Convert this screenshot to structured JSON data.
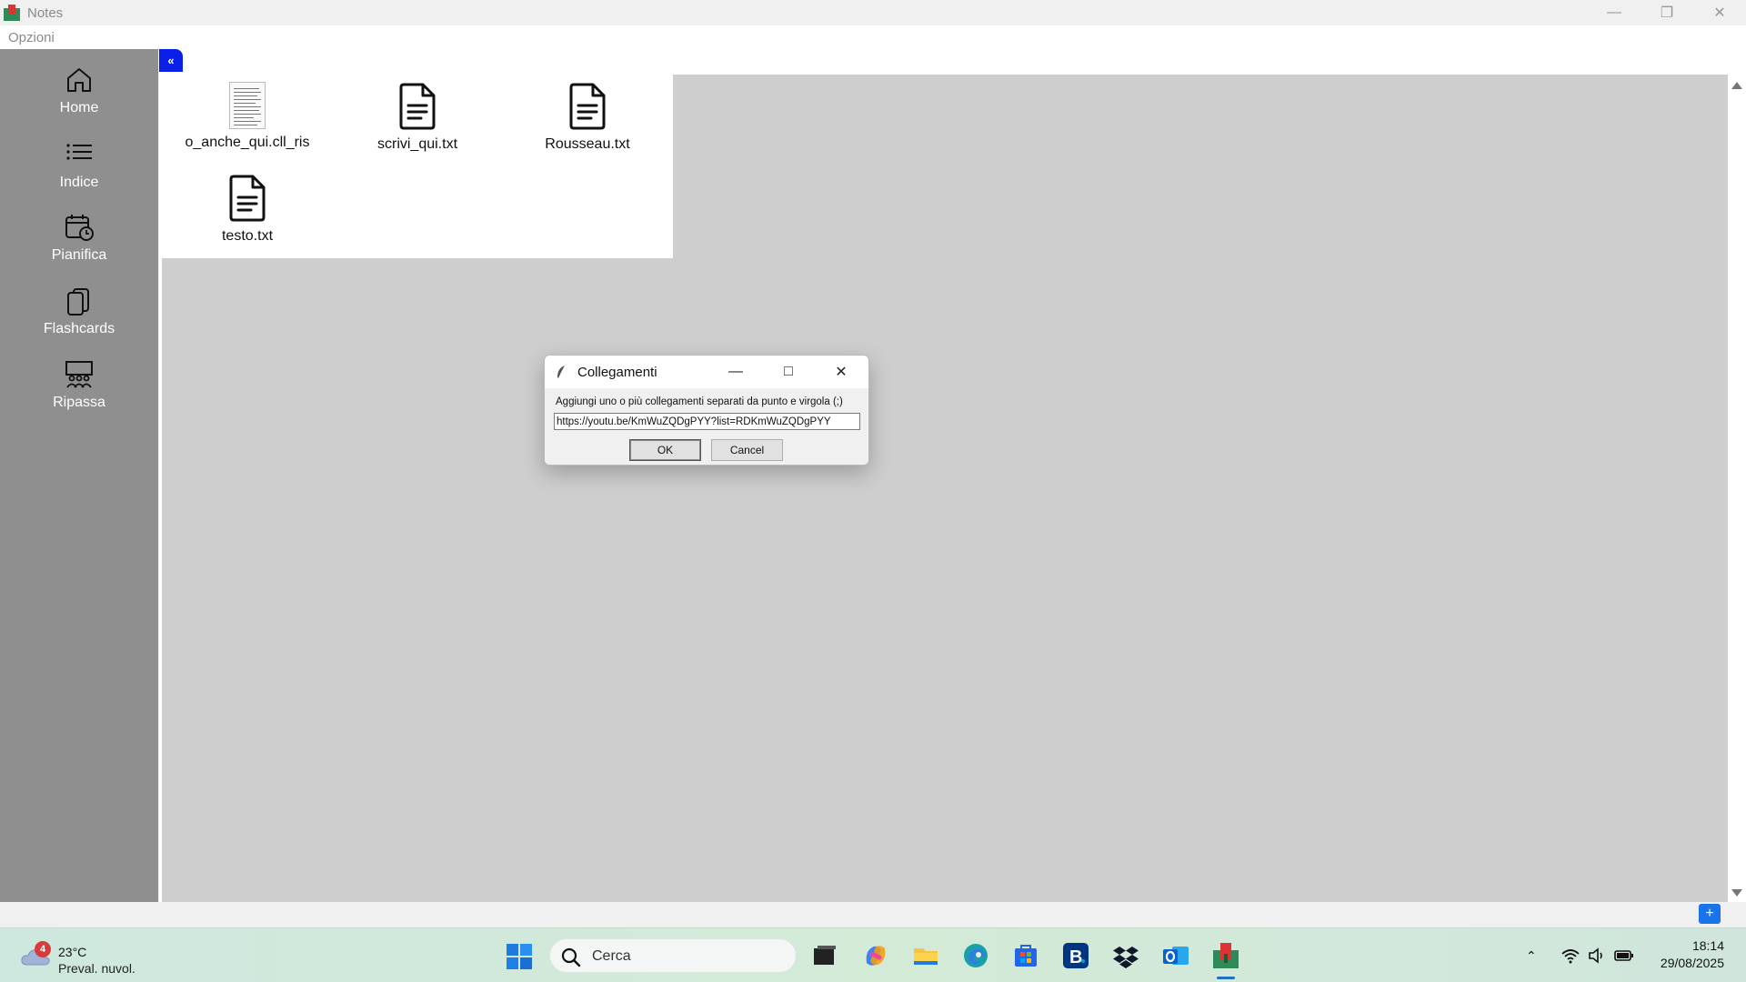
{
  "window": {
    "title": "Notes"
  },
  "menu": {
    "options": "Opzioni"
  },
  "sidebar": {
    "items": [
      {
        "label": "Home",
        "icon": "home-icon"
      },
      {
        "label": "Indice",
        "icon": "list-icon"
      },
      {
        "label": "Pianifica",
        "icon": "calendar-clock-icon"
      },
      {
        "label": "Flashcards",
        "icon": "cards-icon"
      },
      {
        "label": "Ripassa",
        "icon": "classroom-icon"
      }
    ]
  },
  "main": {
    "collapse_label": "«",
    "files": [
      {
        "name": "o_anche_qui.cll_ris",
        "icon": "document-thumbnail"
      },
      {
        "name": "scrivi_qui.txt",
        "icon": "text-file-icon"
      },
      {
        "name": "Rousseau.txt",
        "icon": "text-file-icon"
      },
      {
        "name": "testo.txt",
        "icon": "text-file-icon"
      }
    ],
    "add_label": "+"
  },
  "dialog": {
    "title": "Collegamenti",
    "prompt": "Aggiungi uno o più collegamenti separati da punto e virgola (;)",
    "input_value": "https://youtu.be/KmWuZQDgPYY?list=RDKmWuZQDgPYY",
    "ok_label": "OK",
    "cancel_label": "Cancel"
  },
  "taskbar": {
    "weather": {
      "badge": "4",
      "temp": "23°C",
      "condition": "Preval. nuvol."
    },
    "search_placeholder": "Cerca",
    "clock": {
      "time": "18:14",
      "date": "29/08/2025"
    }
  },
  "colors": {
    "sidebar_bg": "#8f8f8f",
    "accent": "#0a1fe8",
    "content_bg": "#cecece"
  }
}
